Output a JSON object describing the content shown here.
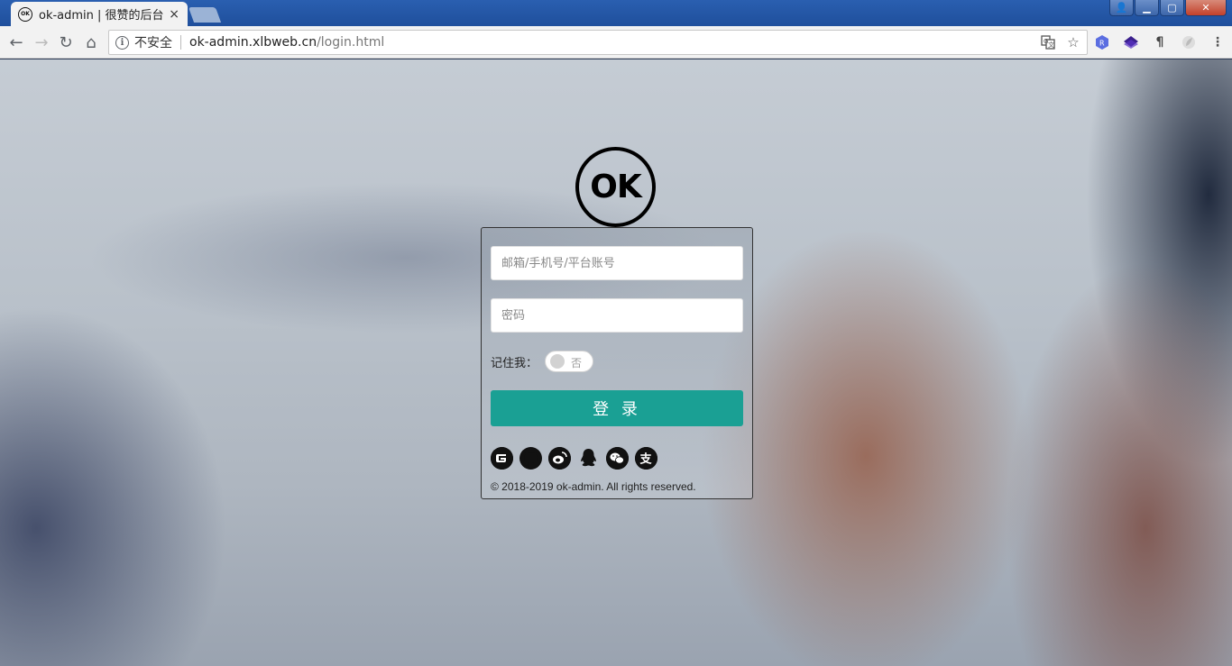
{
  "browser": {
    "tab": {
      "title": "ok-admin | 很赞的后台模",
      "favicon": "OK",
      "close": "×"
    },
    "window_buttons": {
      "user": "👤",
      "minimize": "▁",
      "maximize": "▢",
      "close": "✕"
    },
    "nav": {
      "back": "←",
      "forward": "→",
      "reload": "↻",
      "home": "⌂"
    },
    "address": {
      "security_label": "不安全",
      "host": "ok-admin.xlbweb.cn",
      "path": "/login.html"
    },
    "omnibox_icons": [
      "translate-icon",
      "star-icon"
    ],
    "extensions": [
      "r-extension-icon",
      "layers-extension-icon",
      "pilcrow-extension-icon",
      "leaf-extension-icon",
      "menu-icon"
    ]
  },
  "login": {
    "logo_text": "OK",
    "username_placeholder": "邮箱/手机号/平台账号",
    "password_placeholder": "密码",
    "remember_label": "记住我：",
    "remember_state": "否",
    "submit_label": "登 录",
    "social_icons": [
      "gitee-icon",
      "github-icon",
      "weibo-icon",
      "qq-icon",
      "wechat-icon",
      "alipay-icon"
    ],
    "copyright": "© 2018-2019 ok-admin. All rights reserved."
  },
  "colors": {
    "primary": "#1aa094",
    "titlebar": "#1f4f9c"
  }
}
